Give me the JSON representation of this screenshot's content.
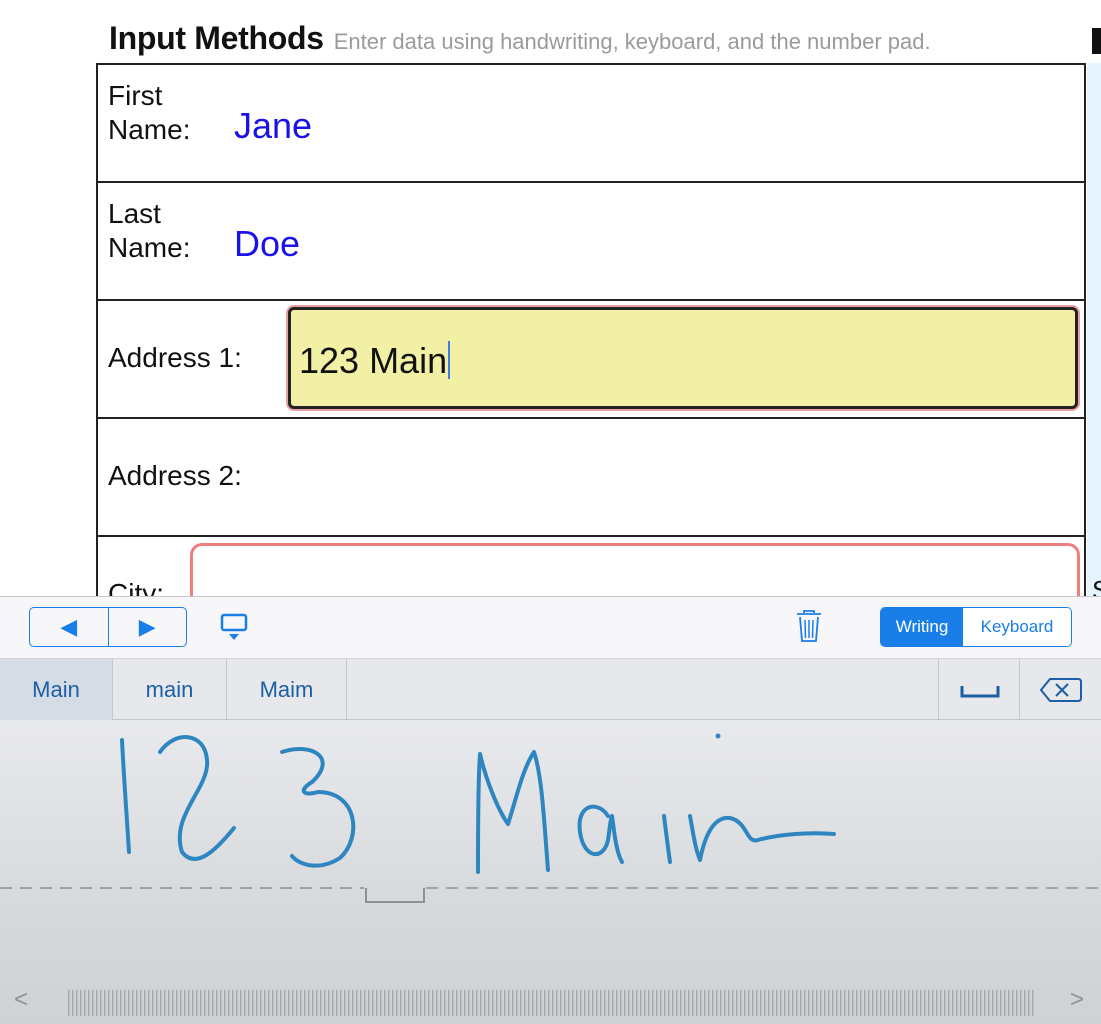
{
  "header": {
    "title": "Input Methods",
    "subtitle": "Enter data using handwriting, keyboard, and the number pad."
  },
  "form": {
    "first_name": {
      "label": "First Name:",
      "value": "Jane"
    },
    "last_name": {
      "label": "Last Name:",
      "value": "Doe"
    },
    "address1": {
      "label": "Address 1:",
      "value": "123 Main"
    },
    "address2": {
      "label": "Address 2:",
      "value": ""
    },
    "city": {
      "label": "City:",
      "value": ""
    },
    "right_column_letter": "S"
  },
  "toolbar": {
    "prev_glyph": "◀",
    "next_glyph": "▶",
    "mode_writing": "Writing",
    "mode_keyboard": "Keyboard",
    "active_mode": "Writing"
  },
  "candidates": {
    "items": [
      "Main",
      "main",
      "Maim"
    ],
    "selected": "Main"
  },
  "handwriting": {
    "ink_text": "123 Main",
    "scroll_left_glyph": "<",
    "scroll_right_glyph": ">"
  },
  "colors": {
    "accent": "#1a7ee8",
    "field_value": "#1a12e8",
    "active_field_bg": "#f2f0a4",
    "invalid_border": "#ef7f7f",
    "ink": "#2e86c1"
  },
  "icons": {
    "prev": "triangle-left-icon",
    "next": "triangle-right-icon",
    "hide_keyboard": "hide-keyboard-icon",
    "trash": "trash-icon",
    "space": "space-icon",
    "delete": "delete-backspace-icon"
  }
}
